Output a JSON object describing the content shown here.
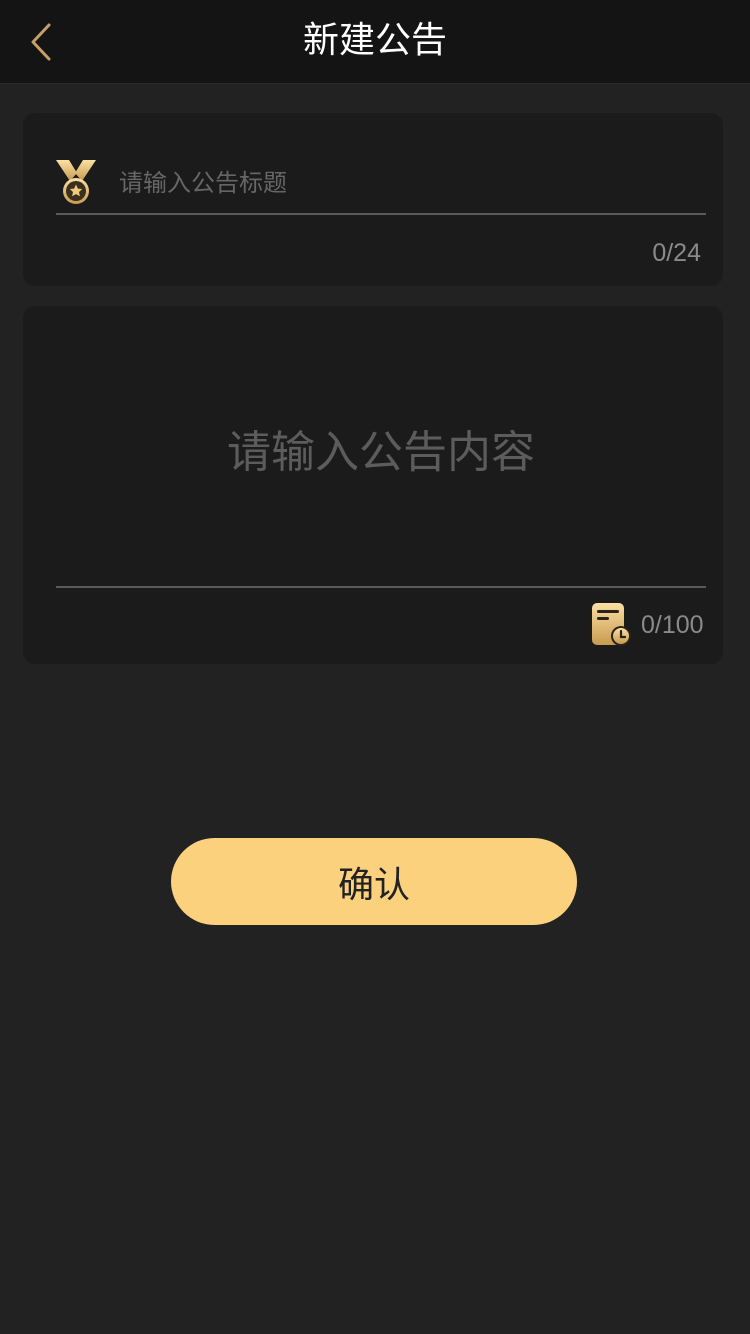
{
  "header": {
    "title": "新建公告",
    "back_icon": "chevron-left-icon",
    "back_color": "#c8a064"
  },
  "title_field": {
    "icon": "medal-icon",
    "placeholder": "请输入公告标题",
    "value": "",
    "counter": "0/24"
  },
  "content_field": {
    "placeholder": "请输入公告内容",
    "value": "",
    "history_icon": "history-list-icon",
    "counter": "0/100"
  },
  "confirm": {
    "label": "确认",
    "color": "#fcd17d"
  },
  "colors": {
    "background": "#222222",
    "nav_background": "#141414",
    "card_background": "#1b1b1c",
    "accent_gold": "#f3c97a"
  }
}
